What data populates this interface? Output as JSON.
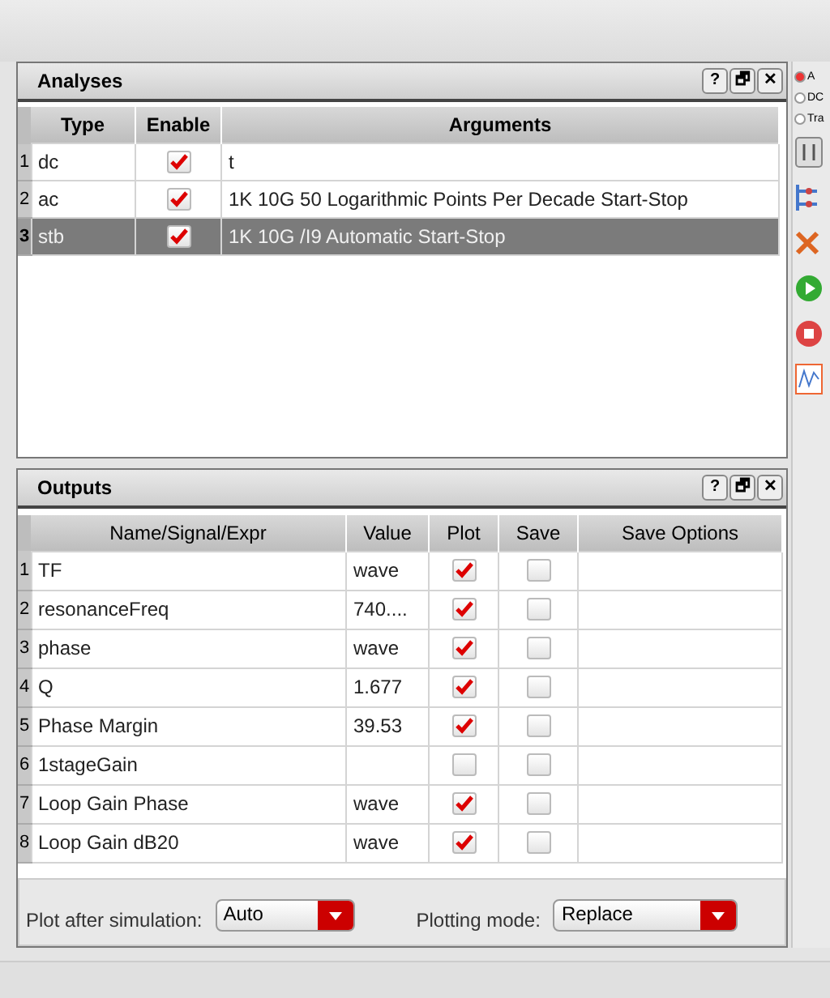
{
  "analyses": {
    "title": "Analyses",
    "buttons": [
      "?",
      "🗗",
      "✕"
    ],
    "columns": [
      "Type",
      "Enable",
      "Arguments"
    ],
    "rows": [
      {
        "index": "1",
        "type": "dc",
        "enabled": true,
        "arguments": "t",
        "selected": false
      },
      {
        "index": "2",
        "type": "ac",
        "enabled": true,
        "arguments": "1K 10G 50 Logarithmic Points Per Decade Start-Stop",
        "selected": false
      },
      {
        "index": "3",
        "type": "stb",
        "enabled": true,
        "arguments": "1K 10G /I9 Automatic Start-Stop",
        "selected": true
      }
    ]
  },
  "side": {
    "radios": [
      {
        "label": "A",
        "selected": true
      },
      {
        "label": "DC",
        "selected": false
      },
      {
        "label": "Tra",
        "selected": false
      }
    ]
  },
  "outputs": {
    "title": "Outputs",
    "buttons": [
      "?",
      "🗗",
      "✕"
    ],
    "columns": [
      "Name/Signal/Expr",
      "Value",
      "Plot",
      "Save",
      "Save Options"
    ],
    "rows": [
      {
        "index": "1",
        "name": "TF",
        "value": "wave",
        "plot": true,
        "save": false
      },
      {
        "index": "2",
        "name": "resonanceFreq",
        "value": "740....",
        "plot": true,
        "save": false
      },
      {
        "index": "3",
        "name": "phase",
        "value": "wave",
        "plot": true,
        "save": false
      },
      {
        "index": "4",
        "name": "Q",
        "value": "1.677",
        "plot": true,
        "save": false
      },
      {
        "index": "5",
        "name": "Phase Margin",
        "value": "39.53",
        "plot": true,
        "save": false
      },
      {
        "index": "6",
        "name": "1stageGain",
        "value": "",
        "plot": false,
        "save": false
      },
      {
        "index": "7",
        "name": "Loop Gain Phase",
        "value": "wave",
        "plot": true,
        "save": false
      },
      {
        "index": "8",
        "name": "Loop Gain dB20",
        "value": "wave",
        "plot": true,
        "save": false
      }
    ]
  },
  "plot_after": {
    "label": "Plot after simulation:",
    "value": "Auto"
  },
  "plotting_mode": {
    "label": "Plotting mode:",
    "value": "Replace"
  }
}
